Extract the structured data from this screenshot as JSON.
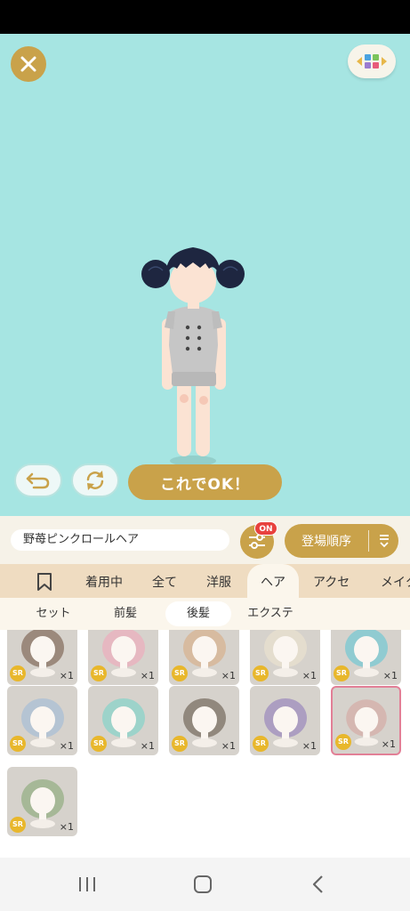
{
  "top": {
    "ok_label": "これでOK！"
  },
  "info": {
    "item_name": "野苺ピンクロールヘア",
    "filter_badge": "ON",
    "sort_label": "登場順序"
  },
  "category_tabs": [
    "着用中",
    "全て",
    "洋服",
    "ヘア",
    "アクセ",
    "メイク"
  ],
  "active_category": "ヘア",
  "sub_tabs": [
    "セット",
    "前髪",
    "後髪",
    "エクステ"
  ],
  "active_sub_tab": "後髪",
  "items": [
    {
      "rarity": "SR",
      "count": "×1",
      "hair_color": "#6b4c3a"
    },
    {
      "rarity": "SR",
      "count": "×1",
      "hair_color": "#f4a3b8"
    },
    {
      "rarity": "SR",
      "count": "×1",
      "hair_color": "#d9a77c"
    },
    {
      "rarity": "SR",
      "count": "×1",
      "hair_color": "#f0e6d0"
    },
    {
      "rarity": "SR",
      "count": "×1",
      "hair_color": "#58c4d6"
    },
    {
      "rarity": "SR",
      "count": "×1",
      "hair_color": "#9bb8d8"
    },
    {
      "rarity": "SR",
      "count": "×1",
      "hair_color": "#6fd4c8"
    },
    {
      "rarity": "SR",
      "count": "×1",
      "hair_color": "#5a4a3c"
    },
    {
      "rarity": "SR",
      "count": "×1",
      "hair_color": "#8a73b8"
    },
    {
      "rarity": "SR",
      "count": "×1",
      "hair_color": "#d6a09a"
    },
    {
      "rarity": "SR",
      "count": "×1",
      "hair_color": "#7fa36b"
    }
  ],
  "selected_item_index": 9,
  "colors": {
    "stage_bg": "#a6e5e2",
    "accent_gold": "#c9a24a",
    "badge_red": "#e8423e",
    "selected_border": "#e27f96"
  }
}
